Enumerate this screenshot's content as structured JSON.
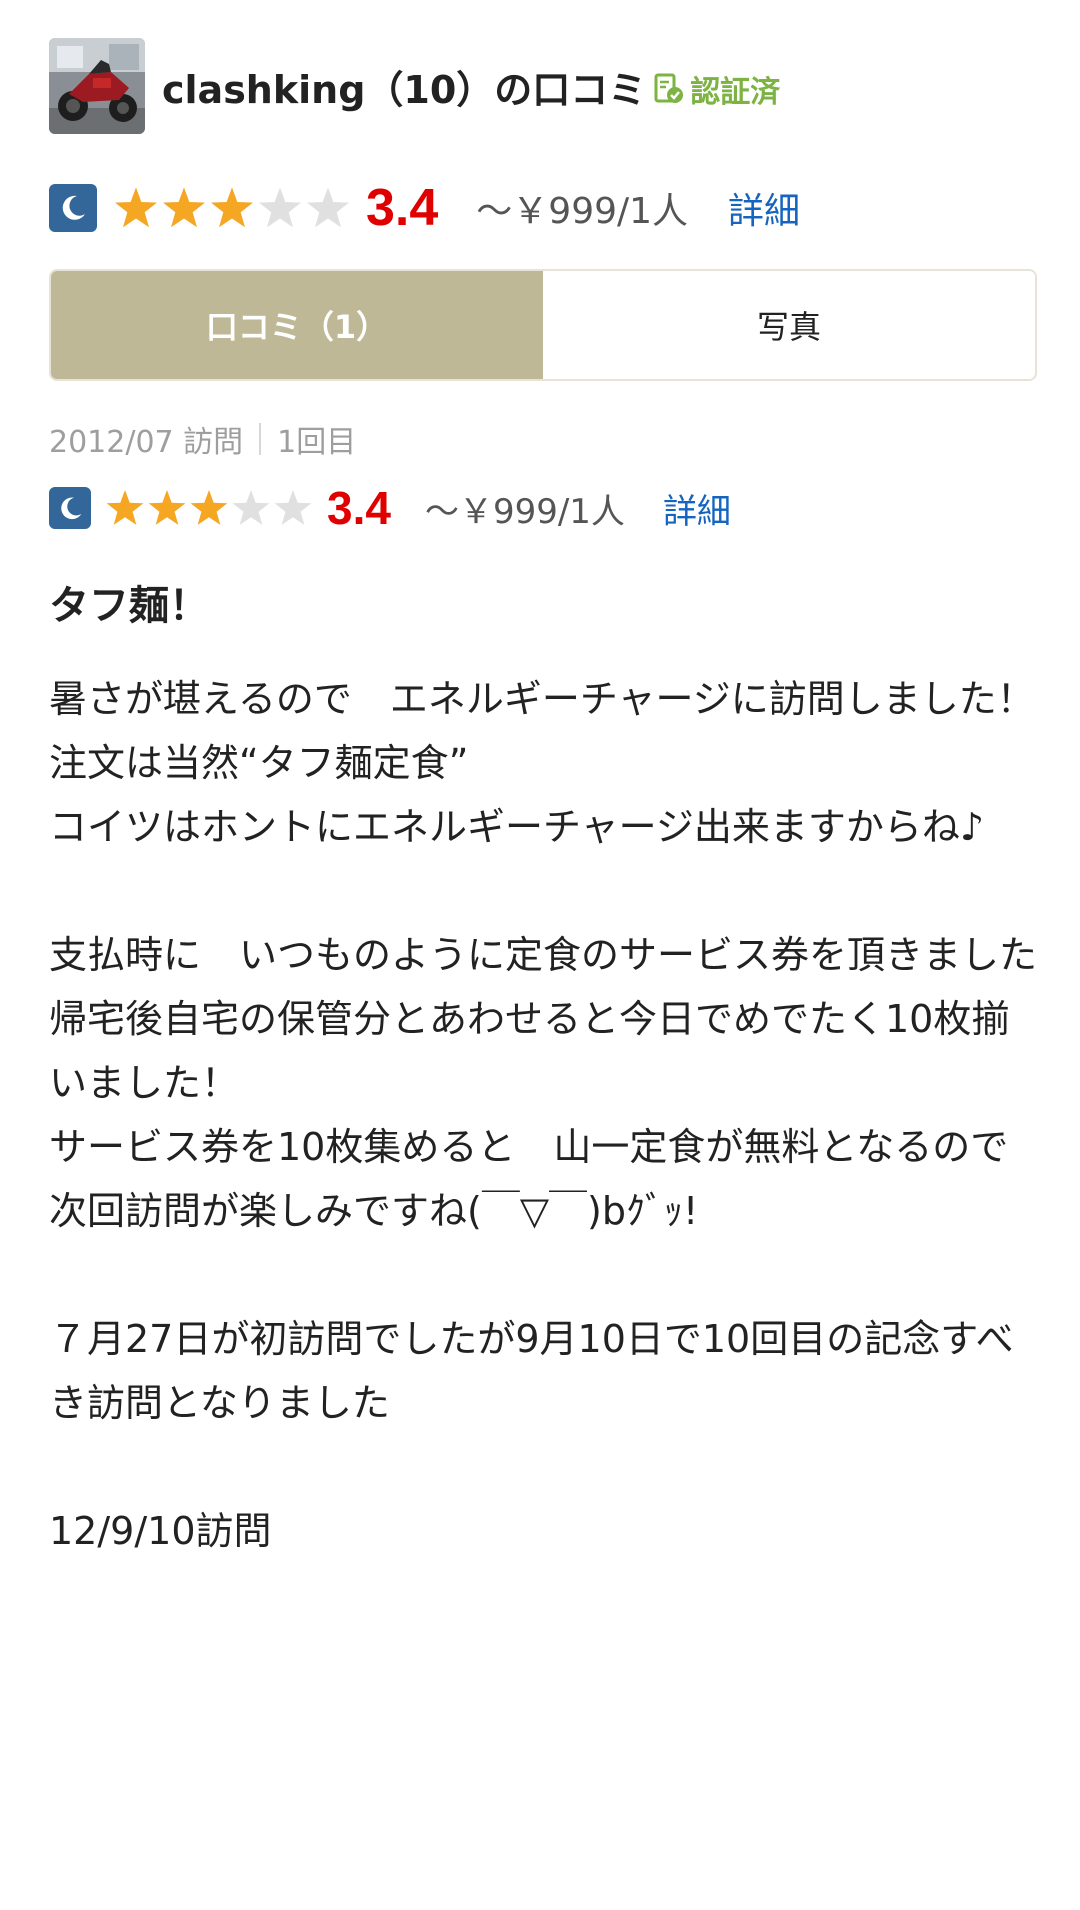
{
  "reviewer": {
    "name": "clashking（10）の口コミ",
    "verified_label": "認証済",
    "avatar_icon": "motorcycle-photo"
  },
  "summary_rating": {
    "time_icon": "moon-icon",
    "score": "3.4",
    "score_value": 3.4,
    "price": "～￥999/1人",
    "details_link": "詳細"
  },
  "tabs": [
    {
      "label": "口コミ（1）",
      "active": true
    },
    {
      "label": "写真",
      "active": false
    }
  ],
  "visit": {
    "date": "2012/07 訪問",
    "count": "1回目"
  },
  "review_rating": {
    "time_icon": "moon-icon",
    "score": "3.4",
    "score_value": 3.4,
    "price": "～￥999/1人",
    "details_link": "詳細"
  },
  "review": {
    "title": "タフ麺！",
    "body": "暑さが堪えるので　エネルギーチャージに訪問しました！\n注文は当然“タフ麺定食”\nコイツはホントにエネルギーチャージ出来ますからね♪\n\n支払時に　いつものように定食のサービス券を頂きました\n帰宅後自宅の保管分とあわせると今日でめでたく10枚揃いました！\nサービス券を10枚集めると　山一定食が無料となるので\n次回訪問が楽しみですね(￣▽￣)bｸﾞｯ!\n\n７月27日が初訪問でしたが9月10日で10回目の記念すべき訪問となりました\n\n12/9/10訪問"
  },
  "colors": {
    "score_red": "#e00000",
    "star_filled": "#f5a623",
    "star_empty": "#e0e0e0",
    "link_blue": "#1565c0",
    "tab_active_bg": "#bfb897",
    "verified_green": "#7cb342",
    "moon_bg": "#336699"
  }
}
